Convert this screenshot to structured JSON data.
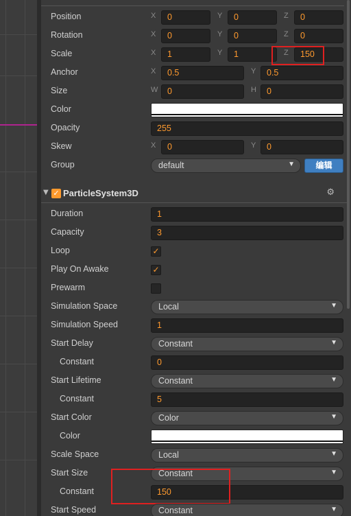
{
  "transform": {
    "position": {
      "label": "Position",
      "x_axis": "X",
      "x": "0",
      "y_axis": "Y",
      "y": "0",
      "z_axis": "Z",
      "z": "0"
    },
    "rotation": {
      "label": "Rotation",
      "x_axis": "X",
      "x": "0",
      "y_axis": "Y",
      "y": "0",
      "z_axis": "Z",
      "z": "0"
    },
    "scale": {
      "label": "Scale",
      "x_axis": "X",
      "x": "1",
      "y_axis": "Y",
      "y": "1",
      "z_axis": "Z",
      "z": "150"
    },
    "anchor": {
      "label": "Anchor",
      "x_axis": "X",
      "x": "0.5",
      "y_axis": "Y",
      "y": "0.5"
    },
    "size": {
      "label": "Size",
      "w_axis": "W",
      "w": "0",
      "h_axis": "H",
      "h": "0"
    },
    "color": {
      "label": "Color",
      "value": "#ffffff"
    },
    "opacity": {
      "label": "Opacity",
      "value": "255"
    },
    "skew": {
      "label": "Skew",
      "x_axis": "X",
      "x": "0",
      "y_axis": "Y",
      "y": "0"
    },
    "group": {
      "label": "Group",
      "value": "default",
      "edit_label": "编辑"
    }
  },
  "particle_system": {
    "title": "ParticleSystem3D",
    "enabled": true,
    "gear_icon": "gear-icon",
    "duration": {
      "label": "Duration",
      "value": "1"
    },
    "capacity": {
      "label": "Capacity",
      "value": "3"
    },
    "loop": {
      "label": "Loop",
      "checked": true
    },
    "play_on_awake": {
      "label": "Play On Awake",
      "checked": true
    },
    "prewarm": {
      "label": "Prewarm",
      "checked": false
    },
    "simulation_space": {
      "label": "Simulation Space",
      "value": "Local"
    },
    "simulation_speed": {
      "label": "Simulation Speed",
      "value": "1"
    },
    "start_delay": {
      "label": "Start Delay",
      "mode": "Constant",
      "sub_label": "Constant",
      "value": "0"
    },
    "start_lifetime": {
      "label": "Start Lifetime",
      "mode": "Constant",
      "sub_label": "Constant",
      "value": "5"
    },
    "start_color": {
      "label": "Start Color",
      "mode": "Color",
      "sub_label": "Color",
      "value": "#ffffff"
    },
    "scale_space": {
      "label": "Scale Space",
      "value": "Local"
    },
    "start_size": {
      "label": "Start Size",
      "mode": "Constant",
      "sub_label": "Constant",
      "value": "150"
    },
    "start_speed": {
      "label": "Start Speed",
      "mode": "Constant"
    }
  },
  "colors": {
    "accent": "#ff9a2e",
    "highlight": "#e02020",
    "button": "#3f7fc1"
  }
}
